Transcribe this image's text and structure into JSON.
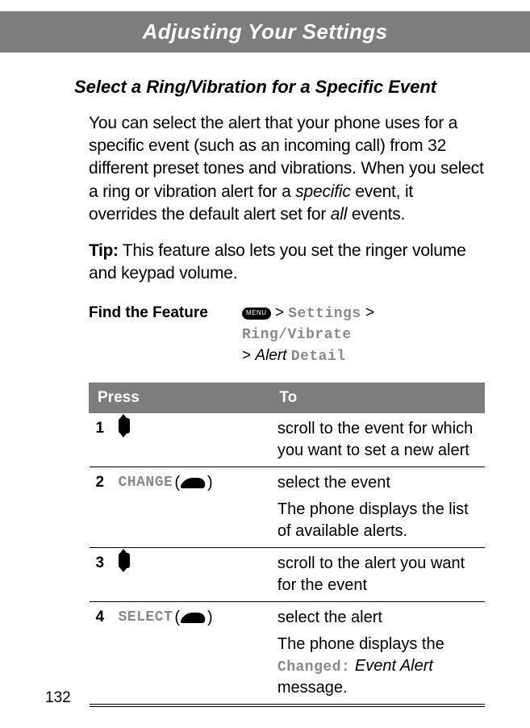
{
  "header": {
    "title": "Adjusting Your Settings"
  },
  "section": {
    "heading": "Select a Ring/Vibration for a Specific Event",
    "intro_html": "You can select the alert that your phone uses for a specific event (such as an incoming call) from 32 different preset tones and vibrations. When you select a ring or vibration alert for a <i>specific</i> event, it overrides the default alert set for <i>all</i> events.",
    "tip_label": "Tip:",
    "tip_text": " This feature also lets you set the ringer volume and keypad volume."
  },
  "find_feature": {
    "label": "Find the Feature",
    "menu_key_text": "MENU",
    "path_parts": {
      "sep": ">",
      "p1": "Settings",
      "p2": "Ring/Vibrate",
      "alert_italic": "Alert",
      "detail": "Detail"
    }
  },
  "table": {
    "headers": {
      "press": "Press",
      "to": "To"
    },
    "rows": [
      {
        "num": "1",
        "press_type": "scroll",
        "to": "scroll to the event for which you want to set a new alert"
      },
      {
        "num": "2",
        "press_type": "soft",
        "soft_label": "CHANGE",
        "to": "select the event",
        "extra": "The phone displays the list of available alerts."
      },
      {
        "num": "3",
        "press_type": "scroll",
        "to": "scroll to the alert you want for the event"
      },
      {
        "num": "4",
        "press_type": "soft",
        "soft_label": "SELECT",
        "to": "select the alert",
        "extra_html": "The phone displays the <span class='ui-path'>Changed:</span> <i>Event Alert</i> message."
      }
    ]
  },
  "page_number": "132"
}
